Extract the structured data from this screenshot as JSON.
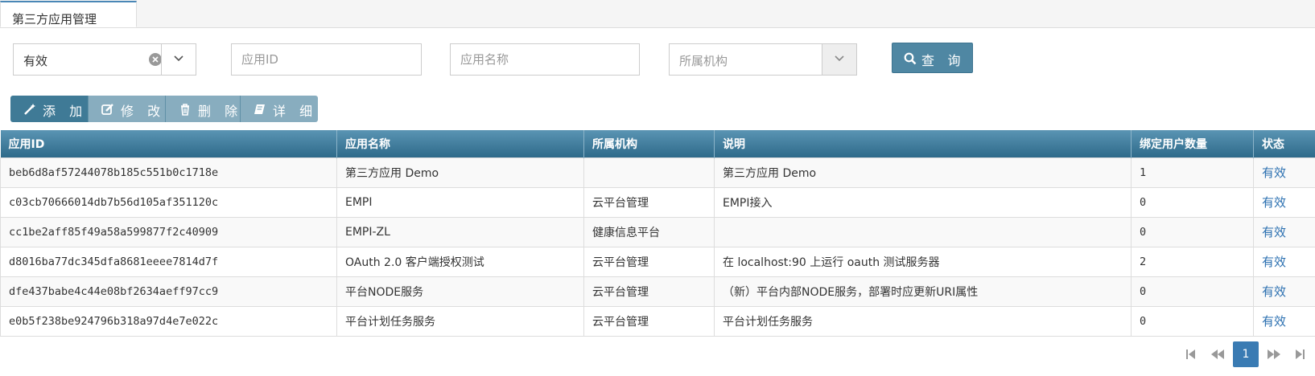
{
  "tab": {
    "title": "第三方应用管理"
  },
  "filters": {
    "status_value": "有效",
    "app_id_placeholder": "应用ID",
    "app_name_placeholder": "应用名称",
    "org_placeholder": "所属机构",
    "query_label": "查 询"
  },
  "toolbar": {
    "add_label": "添 加",
    "edit_label": "修 改",
    "delete_label": "删 除",
    "detail_label": "详 细"
  },
  "table": {
    "headers": [
      "应用ID",
      "应用名称",
      "所属机构",
      "说明",
      "绑定用户数量",
      "状态"
    ],
    "rows": [
      [
        "beb6d8af57244078b185c551b0c1718e",
        "第三方应用 Demo",
        "",
        "第三方应用 Demo",
        "1",
        "有效"
      ],
      [
        "c03cb70666014db7b56d105af351120c",
        "EMPI",
        "云平台管理",
        "EMPI接入",
        "0",
        "有效"
      ],
      [
        "cc1be2aff85f49a58a599877f2c40909",
        "EMPI-ZL",
        "健康信息平台",
        "",
        "0",
        "有效"
      ],
      [
        "d8016ba77dc345dfa8681eeee7814d7f",
        "OAuth 2.0 客户端授权测试",
        "云平台管理",
        "在 localhost:90 上运行 oauth 测试服务器",
        "2",
        "有效"
      ],
      [
        "dfe437babe4c44e08bf2634aeff97cc9",
        "平台NODE服务",
        "云平台管理",
        "（新）平台内部NODE服务，部署时应更新URI属性",
        "0",
        "有效"
      ],
      [
        "e0b5f238be924796b318a97d4e7e022c",
        "平台计划任务服务",
        "云平台管理",
        "平台计划任务服务",
        "0",
        "有效"
      ]
    ]
  },
  "pager": {
    "current_page": "1"
  },
  "colors": {
    "header_bg": "#3a7795",
    "primary_button": "#4f87a3",
    "link": "#2a6fb0",
    "page_active": "#3a7bb3"
  }
}
